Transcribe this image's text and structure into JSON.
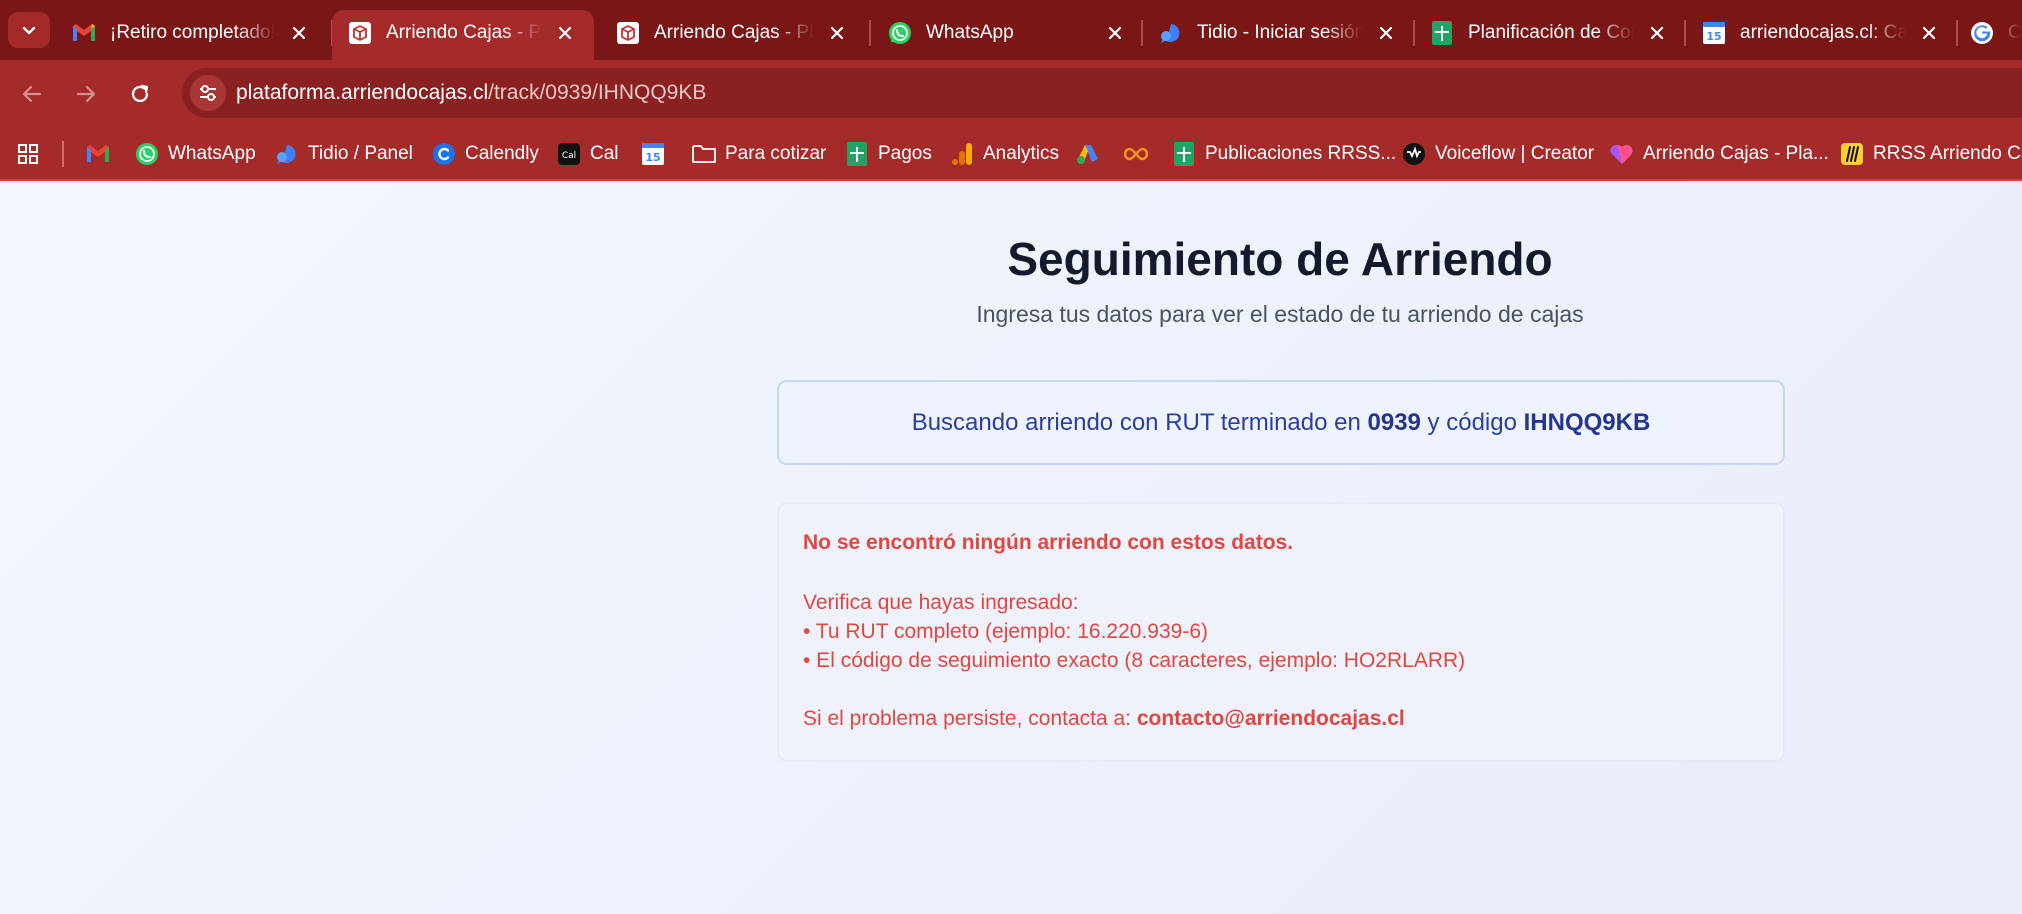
{
  "tabs": [
    {
      "title": "¡Retiro completado! - retiros@arriendocajas.cl",
      "icon": "gmail-icon"
    },
    {
      "title": "Arriendo Cajas - Plataforma",
      "icon": "arriendocajas-icon"
    },
    {
      "title": "Arriendo Cajas - Plataforma",
      "icon": "arriendocajas-icon"
    },
    {
      "title": "WhatsApp",
      "icon": "whatsapp-icon"
    },
    {
      "title": "Tidio - Iniciar sesión",
      "icon": "tidio-icon"
    },
    {
      "title": "Planificación de Contenido",
      "icon": "sheets-icon"
    },
    {
      "title": "arriendocajas.cl: Calendario",
      "icon": "calendar-icon"
    },
    {
      "title": "C",
      "icon": "google-icon"
    }
  ],
  "omnibox": {
    "host": "plataforma.arriendocajas.cl",
    "path": "/track/0939/IHNQQ9KB"
  },
  "bookmarks": [
    {
      "label": "",
      "icon": "gmail-icon"
    },
    {
      "label": "WhatsApp",
      "icon": "whatsapp-icon"
    },
    {
      "label": "Tidio / Panel",
      "icon": "tidio-icon"
    },
    {
      "label": "Calendly",
      "icon": "calendly-icon"
    },
    {
      "label": "Cal",
      "icon": "cal-icon"
    },
    {
      "label": "",
      "icon": "calendar-icon"
    },
    {
      "label": "Para cotizar",
      "icon": "folder-icon"
    },
    {
      "label": "Pagos",
      "icon": "sheets-icon"
    },
    {
      "label": "Analytics",
      "icon": "analytics-icon"
    },
    {
      "label": "",
      "icon": "google-ads-icon"
    },
    {
      "label": "",
      "icon": "infinity-icon"
    },
    {
      "label": "Publicaciones RRSS...",
      "icon": "sheets-icon"
    },
    {
      "label": "Voiceflow | Creator",
      "icon": "voiceflow-icon"
    },
    {
      "label": "Arriendo Cajas - Pla...",
      "icon": "heart-icon"
    },
    {
      "label": "RRSS Arriendo Caja",
      "icon": "miro-icon"
    }
  ],
  "page": {
    "title": "Seguimiento de Arriendo",
    "subtitle": "Ingresa tus datos para ver el estado de tu arriendo de cajas",
    "search": {
      "prefix": "Buscando arriendo con RUT terminado en ",
      "rut": "0939",
      "middle": " y código ",
      "code": "IHNQQ9KB"
    },
    "error": {
      "headline": "No se encontró ningún arriendo con estos datos.",
      "verify": "Verifica que hayas ingresado:",
      "bullet1": "• Tu RUT completo (ejemplo: 16.220.939-6)",
      "bullet2": "• El código de seguimiento exacto (8 caracteres, ejemplo: HO2RLARR)",
      "contact_prefix": "Si el problema persiste, contacta a: ",
      "contact_email": "contacto@arriendocajas.cl"
    }
  },
  "colors": {
    "tabstrip": "#7a1616",
    "toolbar": "#a52a2a",
    "error_text": "#e0473f",
    "search_text": "#2a3f9e"
  }
}
